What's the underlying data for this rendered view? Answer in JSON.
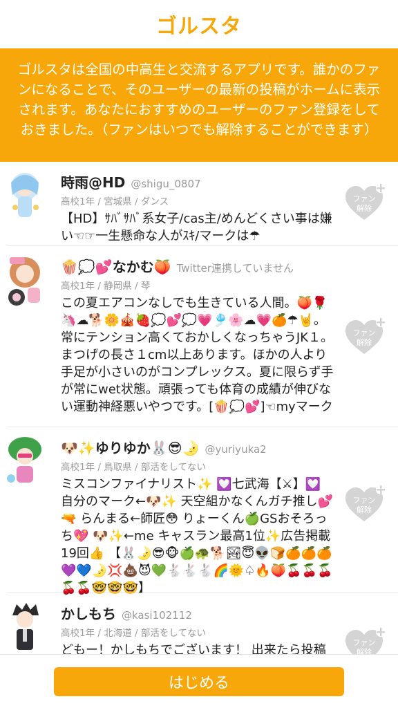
{
  "app": {
    "logo_text": "ゴルスタ"
  },
  "banner": {
    "text": "ゴルスタは全国の中高生と交流するアプリです。誰かのファンになることで、そのユーザーの最新の投稿がホームに表示されます。あなたにおすすめのユーザーのファン登録をしておきました。（ファンはいつでも解除することができます）"
  },
  "fan_button": {
    "label_line1": "ファン",
    "label_line2": "解除",
    "icon": "heart-plus-icon",
    "color": "#d4d4d4"
  },
  "users": [
    {
      "name": "時雨@HD",
      "handle": "@shigu_0807",
      "meta": "高校1年 / 宮城県 / ダンス",
      "bio": "【HD】ｻﾊﾞｻﾊﾞ系女子/cas主/めんどくさい事は嫌い☜☞一生懸命な人がｽｷ/マークは☂"
    },
    {
      "name": "🍿💭💕なかむ🍑",
      "handle": "Twitter連携していません",
      "meta": "高校1年 / 静岡県 / 琴",
      "bio": "この夏エアコンなしでも生きている人間。🍑🌹🦄☁🐕🌼🎪🍓💭💕💭💗🎐🌸☁💗🍊☂🤘。常にテンション高くておかしくなっちゃうJK１。まつげの長さ１cm以上あります。ほかの人より手足が小さいのがコンプレックス。夏に限らず手が常にwet状態。頑張っても体育の成績が伸びない運動神経悪いやつです。[🍿💭💕]☜myマーク"
    },
    {
      "name": "🐶✨ゆりゆか🐰😎🌛",
      "handle": "@yuriyuka2",
      "meta": "高校1年 / 鳥取県 / 部活をしてない",
      "bio": "ミスコンファイナリスト✨ 💟七武海【⚔】💟 自分のマーク←🐶✨ 天空組かなくんガチ推し💕🔫 らんまる←師匠😳 りょーくん🍏GSおそろっち💖 🐶✨←me キャスラン最高1位✨広告掲載19回👍 【🐰🌛😎🐵🍏🐢🐕🏞😇👽🍞🍊🍊🍊💜💙🌛💢💩😈💚🐇🐇🐇🌈🌞♤🔥🍑🍒🍒🍒🍒🍒🤓🤓🤓】"
    },
    {
      "name": "かしもち",
      "handle": "@kasi102112",
      "meta": "高校1年 / 北海道 / 部活をしてない",
      "bio": "どもー！かしもちでございます！ 出来たら投稿いっぱいしていくんで、よろしくです！Twitterフ"
    }
  ],
  "footer": {
    "start_label": "はじめる"
  }
}
